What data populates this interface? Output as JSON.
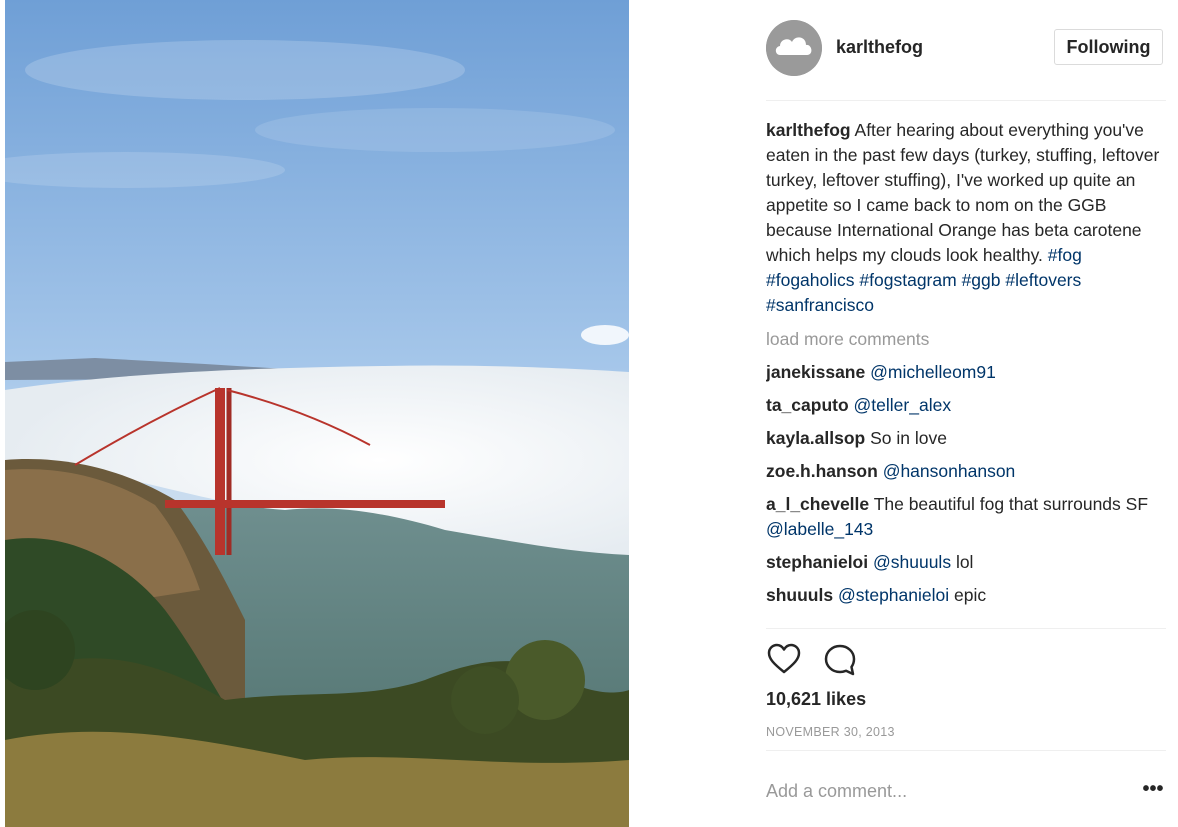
{
  "post": {
    "username": "karlthefog",
    "follow_label": "Following",
    "caption": {
      "username": "karlthefog",
      "text": "After hearing about everything you've eaten in the past few days (turkey, stuffing, leftover turkey, leftover stuffing), I've worked up quite an appetite so I came back to nom on the GGB because International Orange has beta carotene which helps my clouds look healthy.",
      "hashtags": [
        "#fog",
        "#fogaholics",
        "#fogstagram",
        "#ggb",
        "#leftovers",
        "#sanfrancisco"
      ]
    },
    "load_more_label": "load more comments",
    "comments": [
      {
        "username": "janekissane",
        "parts": [
          {
            "text": "@michelleom91",
            "link": true
          }
        ]
      },
      {
        "username": "ta_caputo",
        "parts": [
          {
            "text": "@teller_alex",
            "link": true
          }
        ]
      },
      {
        "username": "kayla.allsop",
        "parts": [
          {
            "text": "So in love",
            "link": false
          }
        ]
      },
      {
        "username": "zoe.h.hanson",
        "parts": [
          {
            "text": "@hansonhanson",
            "link": true
          }
        ]
      },
      {
        "username": "a_l_chevelle",
        "parts": [
          {
            "text": "The beautiful fog that surrounds SF ",
            "link": false
          },
          {
            "text": "@labelle_143",
            "link": true
          }
        ]
      },
      {
        "username": "stephanieloi",
        "parts": [
          {
            "text": "@shuuuls",
            "link": true
          },
          {
            "text": " lol",
            "link": false
          }
        ]
      },
      {
        "username": "shuuuls",
        "parts": [
          {
            "text": "@stephanieloi",
            "link": true
          },
          {
            "text": " epic",
            "link": false
          }
        ]
      }
    ],
    "icons": {
      "like": "heart-icon",
      "comment": "comment-bubble-icon",
      "more": "more-options-icon",
      "avatar": "cloud-icon"
    },
    "likes": "10,621 likes",
    "date": "NOVEMBER 30, 2013",
    "add_comment_placeholder": "Add a comment...",
    "more_label": "•••",
    "colors": {
      "link": "#003569",
      "muted": "#999999",
      "text": "#262626",
      "bridge": "#b8342c"
    }
  }
}
